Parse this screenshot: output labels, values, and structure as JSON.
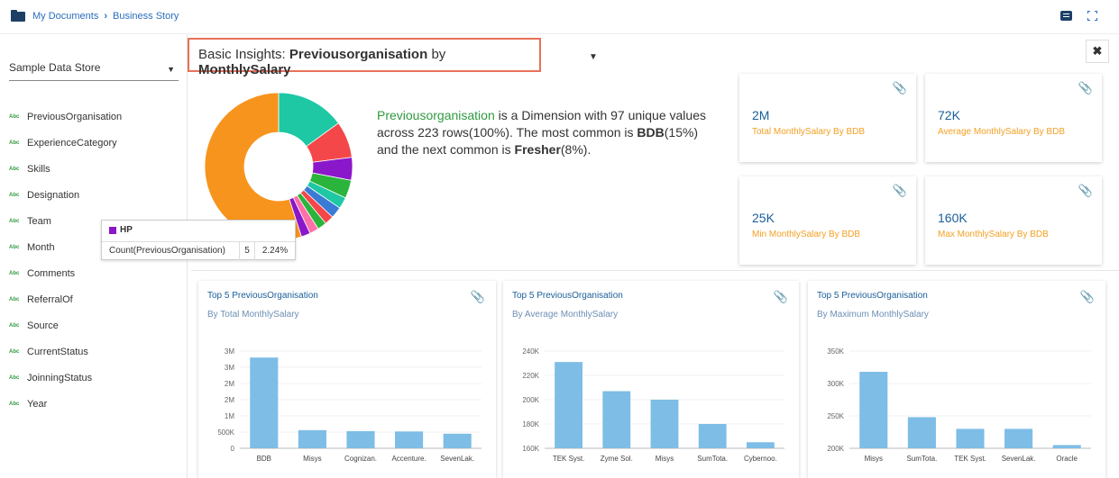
{
  "topbar": {
    "breadcrumb_root": "My Documents",
    "breadcrumb_sep": "›",
    "breadcrumb_current": "Business Story"
  },
  "sidebar": {
    "store": "Sample Data Store",
    "caret": "▼",
    "abc_tag": "Abc",
    "fields": [
      "PreviousOrganisation",
      "ExperienceCategory",
      "Skills",
      "Designation",
      "Team",
      "Month",
      "Comments",
      "ReferralOf",
      "Source",
      "CurrentStatus",
      "JoinningStatus",
      "Year"
    ]
  },
  "header": {
    "prefix": "Basic Insights:",
    "dimension": "Previousorganisation",
    "by": "by",
    "measure": "MonthlySalary",
    "caret": "▼",
    "close": "✖"
  },
  "insight": {
    "name": "Previousorganisation",
    "part1": " is a Dimension with 97 unique values across 223 rows(100%). The most common is ",
    "top1": "BDB",
    "part2": "(15%) and the next common is ",
    "top2": "Fresher",
    "part3": "(8%)."
  },
  "tooltip": {
    "name": "HP",
    "label": "Count(PreviousOrganisation)",
    "count": "5",
    "pct": "2.24%",
    "color": "#8a17c9"
  },
  "donut": {
    "slices": [
      {
        "value": 15,
        "color": "#1ec8a4"
      },
      {
        "value": 8,
        "color": "#f4474a"
      },
      {
        "value": 5,
        "color": "#8a17c9"
      },
      {
        "value": 4,
        "color": "#2ab43c"
      },
      {
        "value": 2.5,
        "color": "#1ec8a4"
      },
      {
        "value": 2.5,
        "color": "#3a7bd5"
      },
      {
        "value": 2,
        "color": "#f4474a"
      },
      {
        "value": 2,
        "color": "#2ab43c"
      },
      {
        "value": 2,
        "color": "#ff6fa8"
      },
      {
        "value": 2,
        "color": "#8a17c9"
      },
      {
        "value": 55,
        "color": "#f7941d"
      }
    ]
  },
  "kpis": [
    {
      "value": "2M",
      "label": "Total MonthlySalary By BDB"
    },
    {
      "value": "72K",
      "label": "Average MonthlySalary By BDB"
    },
    {
      "value": "25K",
      "label": "Min MonthlySalary By BDB"
    },
    {
      "value": "160K",
      "label": "Max MonthlySalary By BDB"
    }
  ],
  "clip_icon": "📎",
  "cards": [
    {
      "title": "Top 5 PreviousOrganisation",
      "subtitle": "By Total MonthlySalary"
    },
    {
      "title": "Top 5 PreviousOrganisation",
      "subtitle": "By Average MonthlySalary"
    },
    {
      "title": "Top 5 PreviousOrganisation",
      "subtitle": "By Maximum MonthlySalary"
    }
  ],
  "chart_data": [
    {
      "type": "bar",
      "categories": [
        "BDB",
        "Misys",
        "Cognizan.",
        "Accenture.",
        "SevenLak."
      ],
      "values": [
        2800000,
        560000,
        530000,
        520000,
        450000
      ],
      "ylim": [
        0,
        3000000
      ],
      "yticks": [
        0,
        500000,
        1000000,
        1500000,
        2000000,
        2500000,
        3000000
      ],
      "ytick_labels": [
        "0",
        "500K",
        "1M",
        "2M",
        "2M",
        "3M",
        "3M"
      ],
      "color": "#7dbde6"
    },
    {
      "type": "bar",
      "categories": [
        "TEK Syst.",
        "Zyme Sol.",
        "Misys",
        "SumTota.",
        "Cybernoo."
      ],
      "values": [
        231000,
        207000,
        200000,
        180000,
        165000
      ],
      "ylim": [
        160000,
        240000
      ],
      "yticks": [
        160000,
        180000,
        200000,
        220000,
        240000
      ],
      "ytick_labels": [
        "160K",
        "180K",
        "200K",
        "220K",
        "240K"
      ],
      "color": "#7dbde6"
    },
    {
      "type": "bar",
      "categories": [
        "Misys",
        "SumTota.",
        "TEK Syst.",
        "SevenLak.",
        "Oracle"
      ],
      "values": [
        318000,
        248000,
        230000,
        230000,
        205000
      ],
      "ylim": [
        200000,
        350000
      ],
      "yticks": [
        200000,
        250000,
        300000,
        350000
      ],
      "ytick_labels": [
        "200K",
        "250K",
        "300K",
        "350K"
      ],
      "color": "#7dbde6"
    }
  ]
}
